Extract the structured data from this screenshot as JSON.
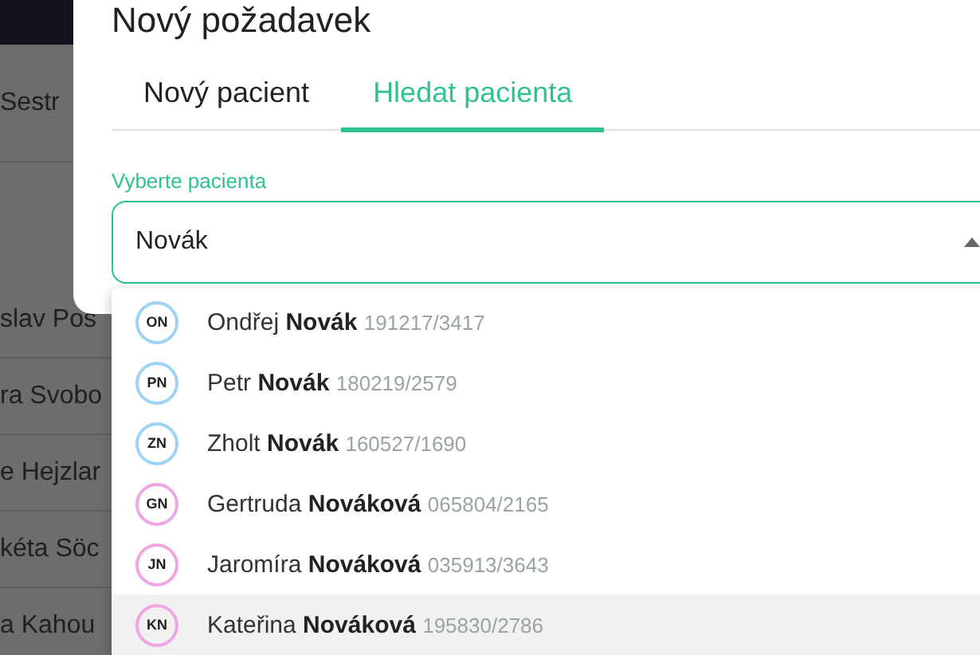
{
  "background_rows": [
    {
      "text": "Sestr"
    },
    {
      "text": "slav Pos"
    },
    {
      "text": "ra Svobo"
    },
    {
      "text": "e Hejzlar"
    },
    {
      "text": "kéta Söc"
    },
    {
      "text": "a Kahou"
    }
  ],
  "dialog": {
    "title": "Nový požadavek",
    "tabs": [
      {
        "label": "Nový pacient",
        "selected": false
      },
      {
        "label": "Hledat pacienta",
        "selected": true
      }
    ],
    "field": {
      "label": "Vyberte pacienta",
      "value": "Novák",
      "expanded": true
    },
    "options": [
      {
        "initials": "ON",
        "first": "Ondřej",
        "last": "Novák",
        "id": "191217/3417",
        "color": "#9ed3f5",
        "selected": false
      },
      {
        "initials": "PN",
        "first": "Petr",
        "last": "Novák",
        "id": "180219/2579",
        "color": "#9ed3f5",
        "selected": false
      },
      {
        "initials": "ZN",
        "first": "Zholt",
        "last": "Novák",
        "id": "160527/1690",
        "color": "#9ed3f5",
        "selected": false
      },
      {
        "initials": "GN",
        "first": "Gertruda",
        "last": "Nováková",
        "id": "065804/2165",
        "color": "#f0a6e4",
        "selected": false
      },
      {
        "initials": "JN",
        "first": "Jaromíra",
        "last": "Nováková",
        "id": "035913/3643",
        "color": "#f0a6e4",
        "selected": false
      },
      {
        "initials": "KN",
        "first": "Kateřina",
        "last": "Nováková",
        "id": "195830/2786",
        "color": "#f0a6e4",
        "selected": true
      }
    ]
  }
}
